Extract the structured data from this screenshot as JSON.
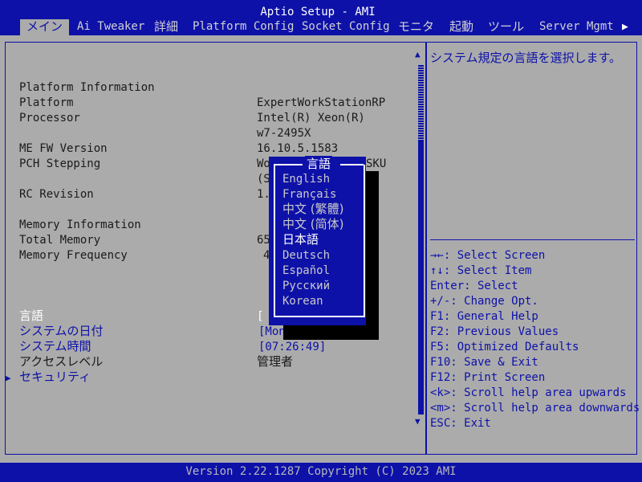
{
  "app_title": "Aptio Setup - AMI",
  "menu": [
    {
      "label": "メイン",
      "active": true
    },
    {
      "label": "Ai Tweaker"
    },
    {
      "label": "詳細"
    },
    {
      "label": "Platform Config"
    },
    {
      "label": "Socket Config"
    },
    {
      "label": "モニタ"
    },
    {
      "label": "起動"
    },
    {
      "label": "ツール"
    },
    {
      "label": "Server Mgmt"
    }
  ],
  "menu_more_icon": "triangle-right",
  "main": {
    "platform_info_header": "Platform Information",
    "platform": {
      "label": "Platform",
      "value": "ExpertWorkStationRP"
    },
    "processor": {
      "label": "Processor",
      "value_line1": "Intel(R) Xeon(R)",
      "value_line2": "w7-2495X"
    },
    "me_fw": {
      "label": "ME FW Version",
      "value": "16.10.5.1583"
    },
    "pch": {
      "label": "PCH Stepping",
      "value_prefix": "Wo",
      "value_suffix": "SKU",
      "value_line2": "(S"
    },
    "rc_revision": {
      "label": "RC Revision",
      "value": "1."
    },
    "memory_info_header": "Memory Information",
    "total_memory": {
      "label": "Total Memory",
      "value": "65"
    },
    "memory_frequency": {
      "label": "Memory Frequency",
      "value": "4"
    },
    "language": {
      "label": "言語",
      "value": "["
    },
    "system_date": {
      "label": "システムの日付",
      "value": "[Mon"
    },
    "system_time": {
      "label": "システム時間",
      "value": "[07:26:49]"
    },
    "access_level": {
      "label": "アクセスレベル",
      "value": "管理者"
    },
    "security": {
      "label": "セキュリティ",
      "pointer": "▶"
    }
  },
  "help": {
    "description": "システム規定の言語を選択します。",
    "keys": [
      "→←: Select Screen",
      "↑↓: Select Item",
      "Enter: Select",
      "+/-: Change Opt.",
      "F1: General Help",
      "F2: Previous Values",
      "F5: Optimized Defaults",
      "F10: Save & Exit",
      "F12: Print Screen",
      "<k>: Scroll help area upwards",
      "<m>: Scroll help area downwards",
      "ESC: Exit"
    ]
  },
  "popup": {
    "title": "言語",
    "options": [
      "English",
      "Français",
      "中文 (繁體)",
      "中文 (简体)",
      "日本語",
      "Deutsch",
      "Español",
      "Русский",
      "Korean"
    ],
    "selected_index": 4
  },
  "scrollbar": {
    "up_arrow": "▲",
    "down_arrow": "▼"
  },
  "footer": "Version 2.22.1287 Copyright (C) 2023 AMI",
  "colors": {
    "bios_blue": "#0d11a8",
    "panel_gray": "#ababab",
    "highlight_white": "#ffffff"
  }
}
